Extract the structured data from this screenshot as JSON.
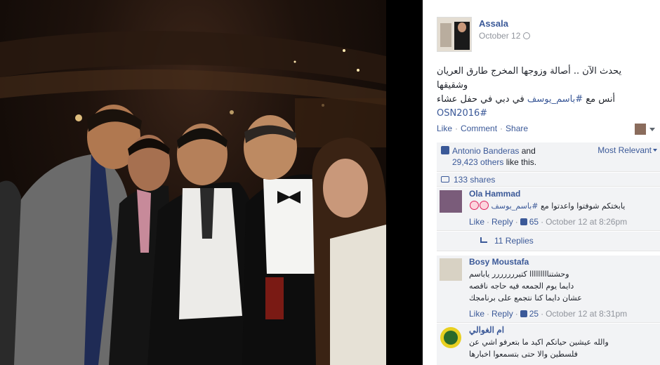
{
  "post": {
    "author": "Assala",
    "date": "October 12",
    "caption_line1": "يحدث الآن .. أصالة وزوجها المخرج طارق العريان وشقيقها",
    "caption_line2_prefix": "أنس مع ",
    "caption_line2_tag": "#باسم_يوسف",
    "caption_line2_suffix": " في دبي في حفل عشاء",
    "caption_line3": "OSN2016#"
  },
  "actions": {
    "like": "Like",
    "comment": "Comment",
    "share": "Share",
    "separator": "·"
  },
  "likes": {
    "name": "Antonio Banderas",
    "and": "and",
    "others": "29,423 others",
    "suffix": "like this.",
    "sort": "Most Relevant"
  },
  "shares": {
    "text": "133 shares"
  },
  "comments": [
    {
      "name": "Ola Hammad",
      "text_prefix": "يابختكم شوفتوا واعدتوا مع ",
      "text_tag": "#باسم_يوسف",
      "like": "Like",
      "reply": "Reply",
      "likes_count": "65",
      "time": "October 12 at 8:26pm"
    },
    {
      "name": "Bosy Moustafa",
      "line1": "وحشتنااااااااا كتيررررررر ياباسم",
      "line2": "دايما يوم الجمعه فيه حاجه ناقصه",
      "line3": "عشان دايما كنا نتجمع على برنامجك",
      "like": "Like",
      "reply": "Reply",
      "likes_count": "25",
      "time": "October 12 at 8:31pm"
    },
    {
      "name": "ام الغوالي",
      "line1": "والله عيشين حياتكم اكيد ما بتعرفو اشي عن",
      "line2": "فلسطين والا حتى بتسمعوا اخبارها"
    }
  ],
  "replies": {
    "text": "11 Replies"
  },
  "colors": {
    "link": "#3b5998",
    "muted": "#90949c",
    "ufi_bg": "#f2f3f5"
  }
}
